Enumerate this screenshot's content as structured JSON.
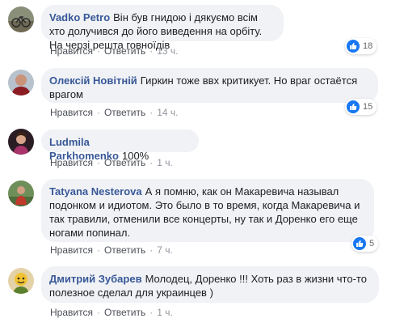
{
  "colors": {
    "author": "#385898",
    "bubble_bg": "#f0f2f5",
    "like_blue": "#1877f2",
    "meta_text": "#90949c"
  },
  "comments": [
    {
      "author": "Vadko Petro",
      "text": "Він був гнидою і дякуємо всім хто долучився до його виведення на орбіту. На черзі решта говноїдів",
      "like_label": "Нравится",
      "reply_label": "Ответить",
      "time": "13 ч.",
      "reactions": "18",
      "avatar_icon": "bicycle-photo-avatar"
    },
    {
      "author": "Олексій Новітній",
      "text": "Гиркин тоже ввх критикует. Но враг остаётся врагом",
      "like_label": "Нравится",
      "reply_label": "Ответить",
      "time": "14 ч.",
      "reactions": "15",
      "avatar_icon": "man-photo-avatar"
    },
    {
      "author": "Ludmila Parkhomenko",
      "text": "100%",
      "like_label": "Нравится",
      "reply_label": "Ответить",
      "time": "1 ч.",
      "reactions": "",
      "avatar_icon": "woman-photo-avatar"
    },
    {
      "author": "Tatyana Nesterova",
      "text": "А я помню, как он Макаревича называл подонком и идиотом. Это было в то время, когда Макаревича и так травили, отменили все концерты, ну так и Доренко его еще ногами попинал.",
      "like_label": "Нравится",
      "reply_label": "Ответить",
      "time": "7 ч.",
      "reactions": "5",
      "avatar_icon": "outdoor-photo-avatar"
    },
    {
      "author": "Дмитрий Зубарев",
      "text": "Молодец, Доренко !!! Хоть раз в жизни что-то полезное сделал для украинцев )",
      "like_label": "Нравится",
      "reply_label": "Ответить",
      "time": "1 ч.",
      "reactions": "",
      "avatar_icon": "cartoon-photo-avatar"
    }
  ]
}
